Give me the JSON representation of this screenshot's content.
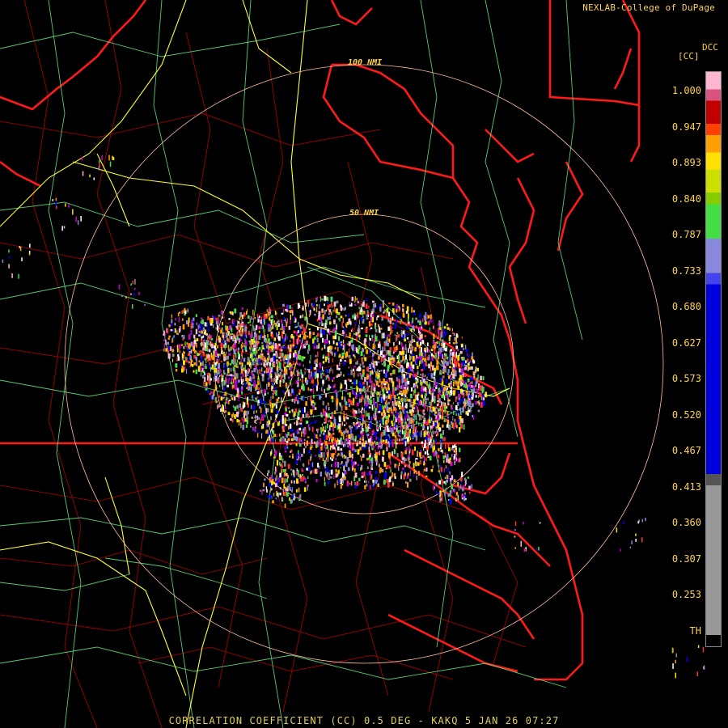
{
  "credit": "NEXLAB-College of DuPage",
  "product_code": "DCC",
  "product_unit": "[CC]",
  "ring_labels": [
    "100 NMI",
    "50 NMI"
  ],
  "footer": "CORRELATION COEFFICIENT (CC) 0.5 DEG - KAKQ 5 JAN 26 07:27",
  "colorbar": {
    "ticks": [
      "1.000",
      "0.947",
      "0.893",
      "0.840",
      "0.787",
      "0.733",
      "0.680",
      "0.627",
      "0.573",
      "0.520",
      "0.467",
      "0.413",
      "0.360",
      "0.307",
      "0.253",
      "TH"
    ],
    "segments": [
      {
        "from": 0.0,
        "to": 0.03,
        "color": "#ffb6d0"
      },
      {
        "from": 0.03,
        "to": 0.05,
        "color": "#d8547e"
      },
      {
        "from": 0.05,
        "to": 0.09,
        "color": "#c00000"
      },
      {
        "from": 0.09,
        "to": 0.11,
        "color": "#ff4000"
      },
      {
        "from": 0.11,
        "to": 0.14,
        "color": "#ffa000"
      },
      {
        "from": 0.14,
        "to": 0.17,
        "color": "#ffe000"
      },
      {
        "from": 0.17,
        "to": 0.21,
        "color": "#cce000"
      },
      {
        "from": 0.21,
        "to": 0.23,
        "color": "#88cc00"
      },
      {
        "from": 0.23,
        "to": 0.29,
        "color": "#44dd44"
      },
      {
        "from": 0.29,
        "to": 0.35,
        "color": "#8888dd"
      },
      {
        "from": 0.35,
        "to": 0.37,
        "color": "#4444ee"
      },
      {
        "from": 0.37,
        "to": 0.7,
        "color": "#0000dd"
      },
      {
        "from": 0.7,
        "to": 0.72,
        "color": "#555555"
      },
      {
        "from": 0.72,
        "to": 0.98,
        "color": "#999999"
      },
      {
        "from": 0.98,
        "to": 1.0,
        "color": "#000000"
      }
    ]
  },
  "colors": {
    "state_borders": "#ff1a1a",
    "county_borders": "#b00000",
    "highways": "#ffff33",
    "roads": "#66ee88",
    "range_rings": "#ffc0a0",
    "label_text": "#ffd24a"
  },
  "radar_site": "KAKQ"
}
